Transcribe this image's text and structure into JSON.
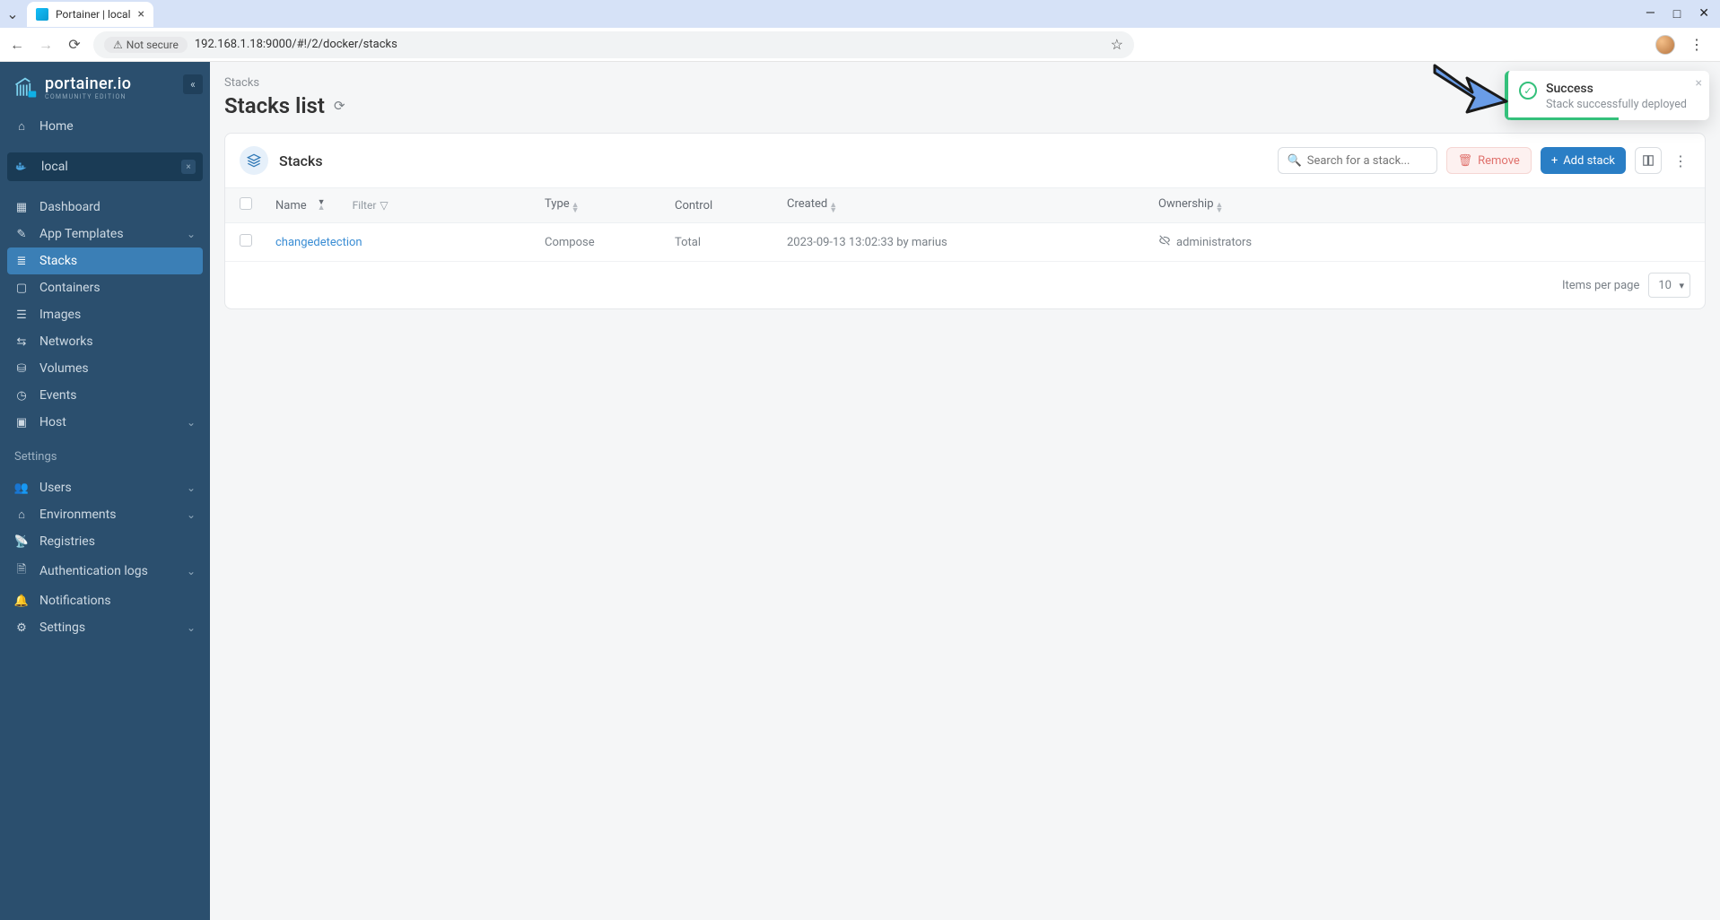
{
  "browser": {
    "tab_title": "Portainer | local",
    "not_secure": "Not secure",
    "url": "192.168.1.18:9000/#!/2/docker/stacks"
  },
  "brand": {
    "name": "portainer.io",
    "sub": "COMMUNITY EDITION"
  },
  "sidebar": {
    "home": "Home",
    "env_name": "local",
    "items": [
      "Dashboard",
      "App Templates",
      "Stacks",
      "Containers",
      "Images",
      "Networks",
      "Volumes",
      "Events",
      "Host"
    ],
    "settings_label": "Settings",
    "settings": [
      "Users",
      "Environments",
      "Registries",
      "Authentication logs",
      "Notifications",
      "Settings"
    ]
  },
  "page": {
    "breadcrumb": "Stacks",
    "title": "Stacks list"
  },
  "card": {
    "title": "Stacks",
    "search_placeholder": "Search for a stack...",
    "remove": "Remove",
    "add": "Add stack"
  },
  "columns": {
    "name": "Name",
    "filter": "Filter",
    "type": "Type",
    "control": "Control",
    "created": "Created",
    "ownership": "Ownership"
  },
  "rows": [
    {
      "name": "changedetection",
      "type": "Compose",
      "control": "Total",
      "created": "2023-09-13 13:02:33 by marius",
      "ownership": "administrators"
    }
  ],
  "footer": {
    "items_label": "Items per page",
    "value": "10"
  },
  "toast": {
    "title": "Success",
    "msg": "Stack successfully deployed"
  }
}
